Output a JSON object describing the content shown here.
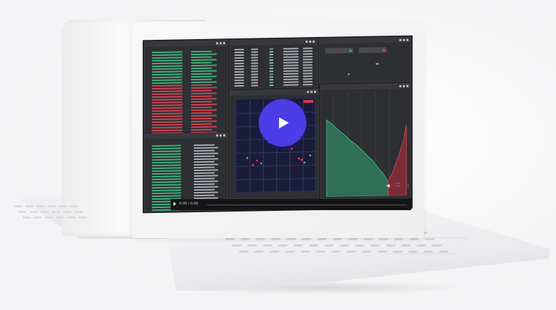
{
  "video": {
    "time_label": "0:00 / 0:00",
    "play_icon": "play-icon"
  },
  "colors": {
    "accent": "#4c3de6",
    "buy": "#3fae7e",
    "sell": "#c94552",
    "alert": "#e0384d"
  },
  "icons": [
    "play-icon",
    "volume-icon",
    "fullscreen-icon",
    "more-icon",
    "minimize-icon",
    "maximize-icon",
    "close-icon"
  ]
}
